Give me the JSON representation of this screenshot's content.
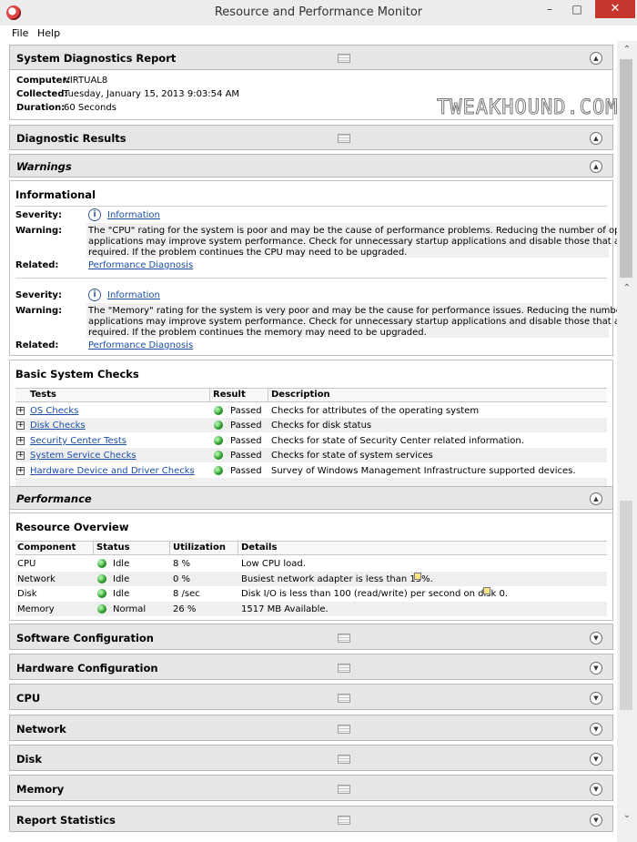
{
  "window": {
    "title": "Resource and Performance Monitor",
    "min": "–",
    "max": "□",
    "close": "✕"
  },
  "menu": [
    "File",
    "Help"
  ],
  "watermark": "TWEAKHOUND.COM",
  "report": {
    "title": "System Diagnostics Report",
    "fields": [
      {
        "label": "Computer:",
        "value": "VIRTUAL8"
      },
      {
        "label": "Collected:",
        "value": "Tuesday, January 15, 2013 9:03:54 AM"
      },
      {
        "label": "Duration:",
        "value": "60 Seconds"
      }
    ]
  },
  "diagnostic": {
    "title": "Diagnostic Results"
  },
  "warnings": {
    "title": "Warnings",
    "subtitle": "Informational",
    "labels": {
      "severity": "Severity:",
      "warning": "Warning:",
      "related": "Related:"
    },
    "items": [
      {
        "severity": "Information",
        "lines": [
          "The \"CPU\" rating for the system is poor and may be the cause of performance problems. Reducing the number of open",
          "applications may improve system performance. Check for unnecessary startup applications and disable those that are not",
          "required. If the problem continues the CPU may need to be upgraded."
        ],
        "related": "Performance Diagnosis"
      },
      {
        "severity": "Information",
        "lines": [
          "The \"Memory\" rating for the system is very poor and may be the cause for performance issues. Reducing the number of open",
          "applications may improve system performance. Check for unnecessary startup applications and disable those that are not",
          "required. If the problem continues the memory may need to be upgraded."
        ],
        "related": "Performance Diagnosis"
      }
    ]
  },
  "checks": {
    "title": "Basic System Checks",
    "headers": [
      "Tests",
      "Result",
      "Description"
    ],
    "rows": [
      {
        "test": "OS Checks",
        "result": "Passed",
        "desc": "Checks for attributes of the operating system"
      },
      {
        "test": "Disk Checks",
        "result": "Passed",
        "desc": "Checks for disk status"
      },
      {
        "test": "Security Center Tests",
        "result": "Passed",
        "desc": "Checks for state of Security Center related information."
      },
      {
        "test": "System Service Checks",
        "result": "Passed",
        "desc": "Checks for state of system services"
      },
      {
        "test": "Hardware Device and Driver Checks",
        "result": "Passed",
        "desc": "Survey of Windows Management Infrastructure supported devices."
      }
    ]
  },
  "performance": {
    "title": "Performance"
  },
  "overview": {
    "title": "Resource Overview",
    "headers": [
      "Component",
      "Status",
      "Utilization",
      "Details"
    ],
    "rows": [
      {
        "component": "CPU",
        "status": "Idle",
        "util": "8 %",
        "details": "Low CPU load."
      },
      {
        "component": "Network",
        "status": "Idle",
        "util": "0 %",
        "details": "Busiest network adapter is less than 15%."
      },
      {
        "component": "Disk",
        "status": "Idle",
        "util": "8 /sec",
        "details": "Disk I/O is less than 100 (read/write) per second on disk 0."
      },
      {
        "component": "Memory",
        "status": "Normal",
        "util": "26 %",
        "details": "1517 MB Available."
      }
    ]
  },
  "collapsed": [
    "Software Configuration",
    "Hardware Configuration",
    "CPU",
    "Network",
    "Disk",
    "Memory",
    "Report Statistics"
  ],
  "icons": {
    "collapse": "▲",
    "expand": "▼",
    "scroll_up": "⌃",
    "scroll_down": "⌄"
  },
  "colors": {
    "close_button": "#c7352f",
    "link": "#1a4ea8",
    "passed_dot": "#2ea02e"
  }
}
